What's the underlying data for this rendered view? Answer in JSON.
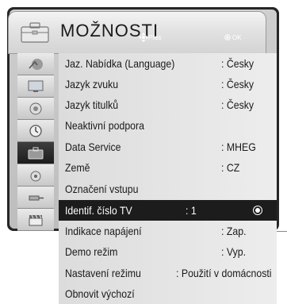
{
  "header": {
    "title": "MOŽNOSTI",
    "hint_move": "Přes",
    "hint_ok": "OK"
  },
  "sidebar": {
    "items": [
      {
        "icon": "picture-icon"
      },
      {
        "icon": "screen-icon"
      },
      {
        "icon": "audio-icon"
      },
      {
        "icon": "clock-icon"
      },
      {
        "icon": "options-briefcase-icon"
      },
      {
        "icon": "lock-icon"
      },
      {
        "icon": "input-plug-icon"
      },
      {
        "icon": "media-clapper-icon"
      }
    ],
    "selected_index": 4
  },
  "menu": {
    "rows": [
      {
        "label": "Jaz. Nabídka (Language)",
        "value": ": Česky"
      },
      {
        "label": "Jazyk zvuku",
        "value": ": Česky"
      },
      {
        "label": "Jazyk titulků",
        "value": ": Česky"
      },
      {
        "label": "Neaktivní podpora",
        "value": ""
      },
      {
        "label": "Data Service",
        "value": ": MHEG"
      },
      {
        "label": "Země",
        "value": ": CZ"
      },
      {
        "label": "Označení vstupu",
        "value": ""
      },
      {
        "label": "Identif. číslo TV",
        "value": ": 1"
      },
      {
        "label": "Indikace napájení",
        "value": ": Zap."
      },
      {
        "label": "Demo režim",
        "value": ": Vyp."
      },
      {
        "label": "Nastavení režimu",
        "value": ": Použití v domácnosti"
      },
      {
        "label": "Obnovit výchozí",
        "value": ""
      }
    ],
    "selected_index": 7
  },
  "colors": {
    "selected_bg": "#1c1c1c",
    "panel_bg": "#e4e4e4",
    "frame": "#262626"
  }
}
